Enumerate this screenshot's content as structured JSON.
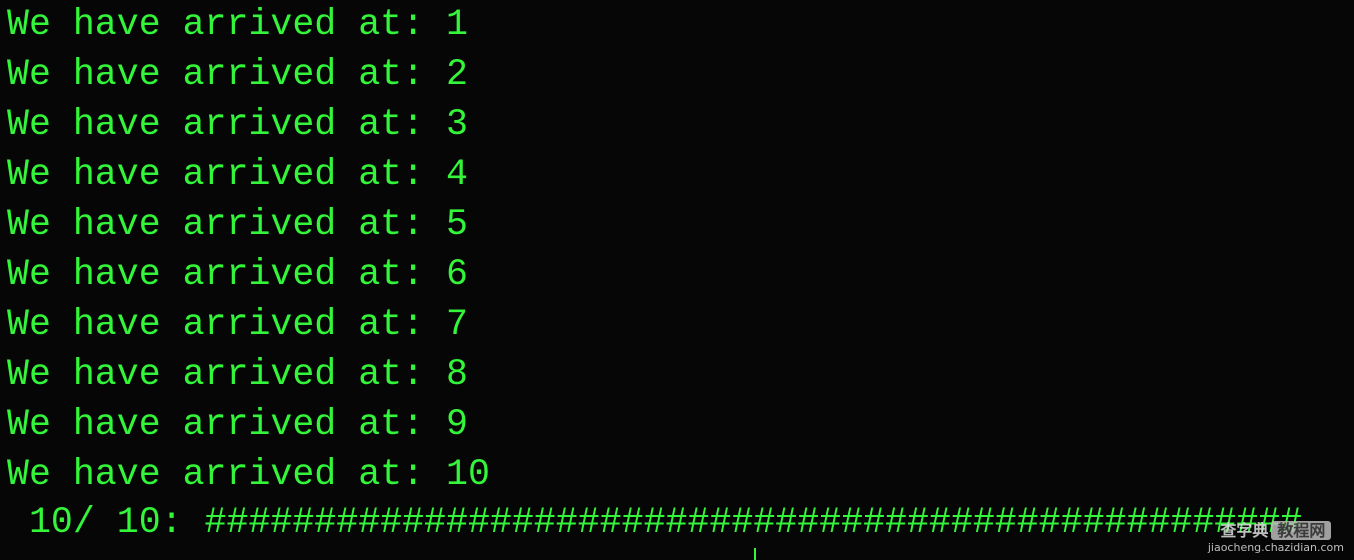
{
  "terminal": {
    "lines": [
      "We have arrived at: 1",
      "We have arrived at: 2",
      "We have arrived at: 3",
      "We have arrived at: 4",
      "We have arrived at: 5",
      "We have arrived at: 6",
      "We have arrived at: 7",
      "We have arrived at: 8",
      "We have arrived at: 9",
      "We have arrived at: 10"
    ],
    "progress": " 10/ 10: ##################################################",
    "progress_percent": 100,
    "text_color": "#33f53a",
    "background": "#060606"
  },
  "watermark": {
    "brand": "查字典",
    "tag": "教程网",
    "url": "jiaocheng.chazidian.com"
  }
}
